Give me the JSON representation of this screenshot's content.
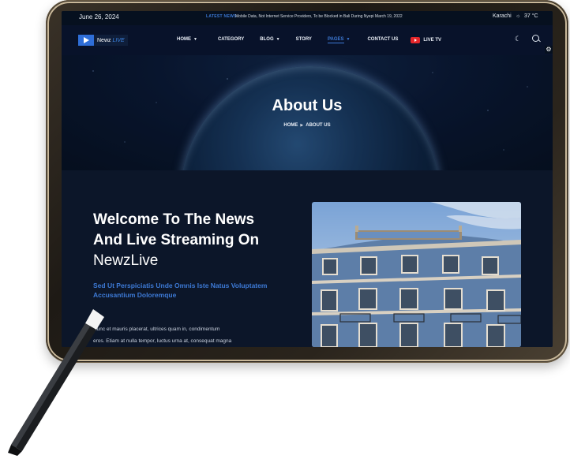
{
  "topbar": {
    "date": "June 26, 2024",
    "news_label": "LATEST NEWS",
    "news_text": "Mobile Data, Not Internet Service Providers, To be Blocked in Bali During Nyepi March 19, 2022",
    "city": "Karachi",
    "weather_icon": "sun-cloud-icon",
    "temperature": "37 °C"
  },
  "logo": {
    "name": "Newz",
    "suffix": "LIVE"
  },
  "nav": {
    "items": [
      {
        "label": "HOME",
        "dropdown": true
      },
      {
        "label": "CATEGORY",
        "dropdown": false
      },
      {
        "label": "BLOG",
        "dropdown": true
      },
      {
        "label": "STORY",
        "dropdown": false
      },
      {
        "label": "PAGES",
        "dropdown": true,
        "active": true
      },
      {
        "label": "CONTACT US",
        "dropdown": false
      }
    ],
    "live_tv": "LIVE TV"
  },
  "hero": {
    "title": "About Us",
    "breadcrumb_home": "HOME",
    "breadcrumb_current": "ABOUT US"
  },
  "content": {
    "heading_line1": "Welcome To The News",
    "heading_line2": "And Live Streaming On",
    "heading_line3": "NewzLive",
    "subtitle": "Sed Ut Perspiciatis Unde Omnis Iste Natus Voluptatem Accusantium Doloremque",
    "body_line1": "Nunc et mauris placerat, ultrices quam in, condimentum",
    "body_line2": "eros. Etiam at nulla tempor, luctus urna at, consequat magna"
  },
  "colors": {
    "accent": "#3d7ad6",
    "background": "#0b1425",
    "live_tv_red": "#e4262a"
  }
}
